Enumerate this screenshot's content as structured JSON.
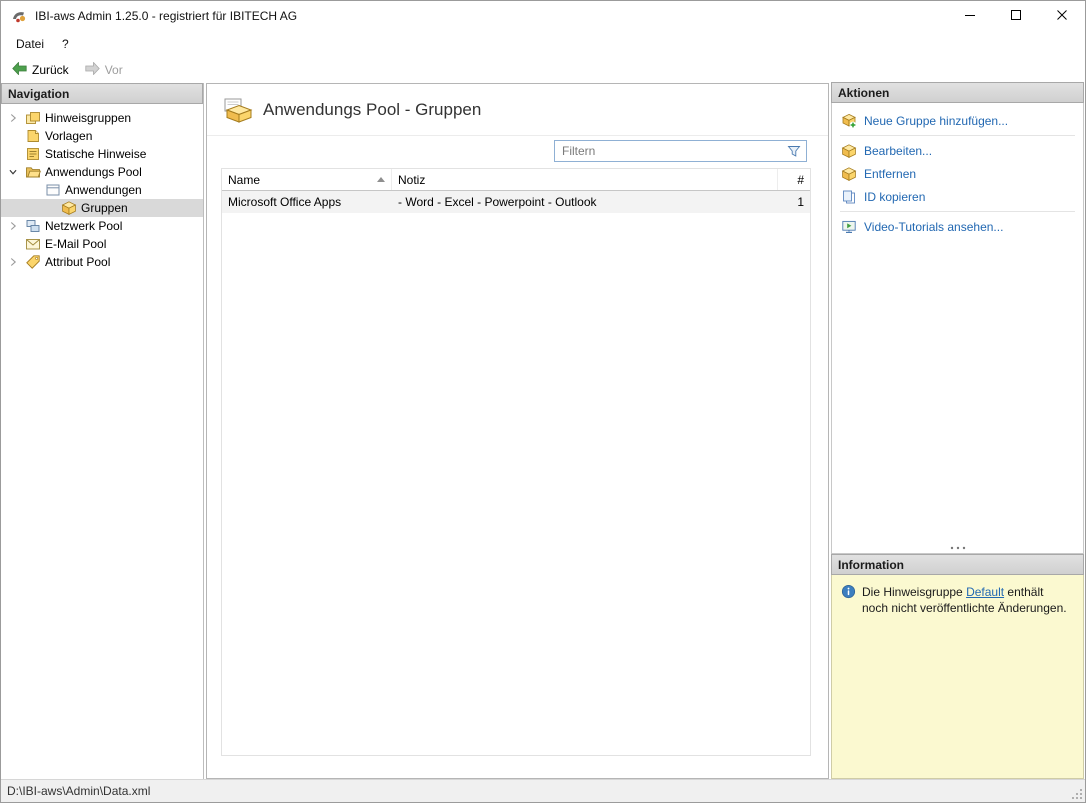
{
  "window": {
    "title": "IBI-aws Admin 1.25.0 - registriert für IBITECH AG"
  },
  "menu": {
    "items": [
      {
        "label": "Datei"
      },
      {
        "label": "?"
      }
    ]
  },
  "toolbar": {
    "back_label": "Zurück",
    "forward_label": "Vor",
    "back_enabled": true,
    "forward_enabled": false
  },
  "navigation": {
    "header": "Navigation",
    "items": [
      {
        "label": "Hinweisgruppen",
        "level": 0,
        "expander": "collapsed",
        "icon": "notice-groups-icon",
        "selected": false
      },
      {
        "label": "Vorlagen",
        "level": 0,
        "expander": "none",
        "icon": "template-icon",
        "selected": false
      },
      {
        "label": "Statische Hinweise",
        "level": 0,
        "expander": "none",
        "icon": "static-notice-icon",
        "selected": false
      },
      {
        "label": "Anwendungs Pool",
        "level": 0,
        "expander": "expanded",
        "icon": "open-folder-icon",
        "selected": false
      },
      {
        "label": "Anwendungen",
        "level": 1,
        "expander": "none",
        "icon": "application-window-icon",
        "selected": false
      },
      {
        "label": "Gruppen",
        "level": 2,
        "expander": "none",
        "icon": "group-box-icon",
        "selected": true
      },
      {
        "label": "Netzwerk Pool",
        "level": 0,
        "expander": "collapsed",
        "icon": "network-icon",
        "selected": false
      },
      {
        "label": "E-Mail Pool",
        "level": 0,
        "expander": "none",
        "icon": "email-icon",
        "selected": false
      },
      {
        "label": "Attribut Pool",
        "level": 0,
        "expander": "collapsed",
        "icon": "attribute-tag-icon",
        "selected": false
      }
    ]
  },
  "main": {
    "title": "Anwendungs Pool - Gruppen",
    "filter_placeholder": "Filtern",
    "table": {
      "columns": [
        {
          "label": "Name"
        },
        {
          "label": "Notiz"
        },
        {
          "label": "#"
        }
      ],
      "sorted_column": "Name",
      "sort_direction": "ascending",
      "rows": [
        {
          "name": "Microsoft Office Apps",
          "notiz": "- Word - Excel - Powerpoint - Outlook",
          "count": "1"
        }
      ]
    }
  },
  "actions": {
    "header": "Aktionen",
    "items": [
      {
        "label": "Neue Gruppe hinzufügen...",
        "icon": "add-group-icon"
      },
      {
        "label": "Bearbeiten...",
        "icon": "edit-group-icon"
      },
      {
        "label": "Entfernen",
        "icon": "remove-group-icon"
      },
      {
        "label": "ID kopieren",
        "icon": "copy-id-icon"
      },
      {
        "label": "Video-Tutorials ansehen...",
        "icon": "video-tutorials-icon"
      }
    ]
  },
  "information": {
    "header": "Information",
    "text_before": "Die Hinweisgruppe ",
    "link_text": "Default",
    "text_after": " enthält noch nicht veröffentlichte Änderungen."
  },
  "statusbar": {
    "path": "D:\\IBI-aws\\Admin\\Data.xml"
  },
  "colors": {
    "link_blue": "#2268b2",
    "info_background": "#fbf9d0",
    "selection_background": "#d9d9d9"
  }
}
